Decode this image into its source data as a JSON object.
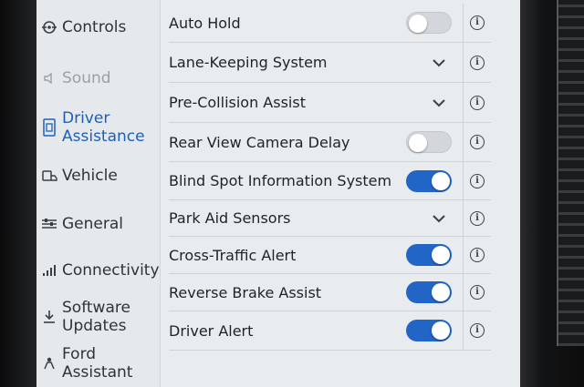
{
  "sidebar": {
    "items": [
      {
        "label": "Controls",
        "icon": "controls-icon",
        "state": "normal"
      },
      {
        "label": "Sound",
        "icon": "speaker-icon",
        "state": "disabled"
      },
      {
        "label": "Driver Assistance",
        "icon": "driver-assist-icon",
        "state": "selected"
      },
      {
        "label": "Vehicle",
        "icon": "vehicle-icon",
        "state": "normal"
      },
      {
        "label": "General",
        "icon": "sliders-icon",
        "state": "normal"
      },
      {
        "label": "Connectivity",
        "icon": "signal-bars-icon",
        "state": "normal"
      },
      {
        "label": "Software Updates",
        "icon": "download-icon",
        "state": "normal"
      },
      {
        "label": "Ford Assistant",
        "icon": "assistant-icon",
        "state": "normal"
      }
    ]
  },
  "settings": {
    "rows": [
      {
        "label": "Auto Hold",
        "control": "toggle",
        "on": false
      },
      {
        "label": "Lane-Keeping System",
        "control": "expand"
      },
      {
        "label": "Pre-Collision Assist",
        "control": "expand"
      },
      {
        "label": "Rear View Camera Delay",
        "control": "toggle",
        "on": false
      },
      {
        "label": "Blind Spot Information System",
        "control": "toggle",
        "on": true
      },
      {
        "label": "Park Aid Sensors",
        "control": "expand"
      },
      {
        "label": "Cross-Traffic Alert",
        "control": "toggle",
        "on": true
      },
      {
        "label": "Reverse Brake Assist",
        "control": "toggle",
        "on": true
      },
      {
        "label": "Driver Alert",
        "control": "toggle",
        "on": true
      }
    ],
    "info_glyph": "i"
  },
  "colors": {
    "accent": "#2165c6",
    "selected_text": "#1d5fb8",
    "toggle_off": "#d3d6da",
    "screen_bg": "#e9ecef"
  }
}
